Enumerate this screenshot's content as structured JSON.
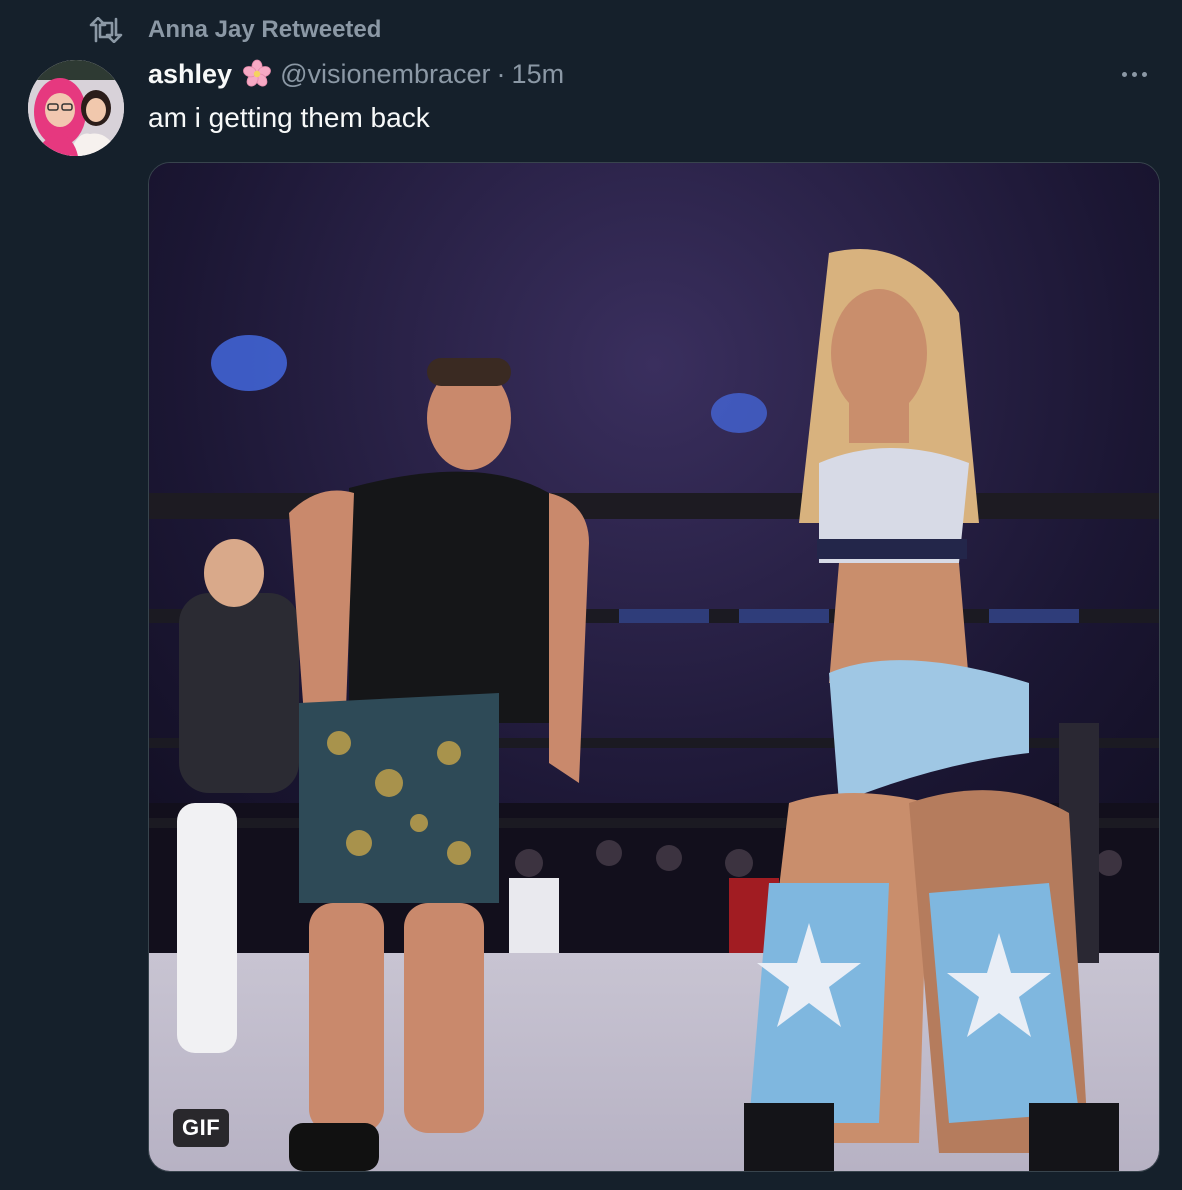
{
  "retweet": {
    "icon": "retweet-icon",
    "label": "Anna Jay Retweeted"
  },
  "author": {
    "display_name": "ashley",
    "name_emoji": "cherry-blossom-icon",
    "handle": "@visionembracer",
    "separator": "·",
    "time": "15m"
  },
  "tweet": {
    "text": "am i getting them back"
  },
  "media": {
    "type": "gif",
    "badge": "GIF"
  },
  "more_icon": "more-horizontal-icon",
  "colors": {
    "background": "#15202b",
    "primary_text": "#f7f9f9",
    "secondary_text": "#8b98a5",
    "border": "#38444d"
  }
}
